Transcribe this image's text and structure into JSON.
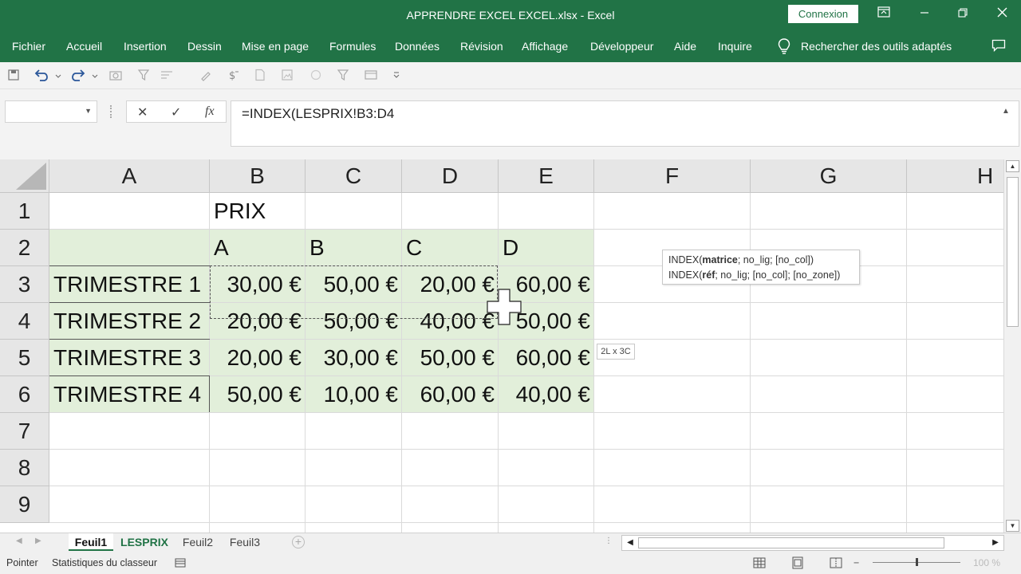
{
  "window": {
    "title": "APPRENDRE EXCEL EXCEL.xlsx  -  Excel",
    "connexion_label": "Connexion"
  },
  "colors": {
    "brand": "#217346",
    "table_fill": "#e2efda"
  },
  "menu": [
    "Fichier",
    "Accueil",
    "Insertion",
    "Dessin",
    "Mise en page",
    "Formules",
    "Données",
    "Révision",
    "Affichage",
    "Développeur",
    "Aide",
    "Inquire",
    "Rechercher des outils adaptés"
  ],
  "formula_bar": {
    "name_box": "",
    "cancel_symbol": "✕",
    "enter_symbol": "✓",
    "fx_symbol": "fx",
    "formula": "=INDEX(LESPRIX!B3:D4"
  },
  "grid": {
    "columns": [
      "A",
      "B",
      "C",
      "D",
      "E",
      "F",
      "G",
      "H"
    ],
    "rows": [
      "1",
      "2",
      "3",
      "4",
      "5",
      "6",
      "7",
      "8",
      "9"
    ],
    "b1": "PRIX",
    "headers_row2": [
      "A",
      "B",
      "C",
      "D"
    ],
    "table": [
      {
        "label": "TRIMESTRE 1",
        "values": [
          "30,00 €",
          "50,00 €",
          "20,00 €",
          "60,00 €"
        ]
      },
      {
        "label": "TRIMESTRE 2",
        "values": [
          "20,00 €",
          "50,00 €",
          "40,00 €",
          "50,00 €"
        ]
      },
      {
        "label": "TRIMESTRE 3",
        "values": [
          "20,00 €",
          "30,00 €",
          "50,00 €",
          "60,00 €"
        ]
      },
      {
        "label": "TRIMESTRE 4",
        "values": [
          "50,00 €",
          "10,00 €",
          "60,00 €",
          "40,00 €"
        ]
      }
    ]
  },
  "tooltip": {
    "line1": {
      "func": "INDEX(",
      "bold": "matrice",
      "rest": "; no_lig; [no_col])"
    },
    "line2": {
      "func": "INDEX(",
      "bold": "réf",
      "rest": "; no_lig; [no_col]; [no_zone])"
    }
  },
  "size_tip": "2L x 3C",
  "sheets": [
    "Feuil1",
    "LESPRIX",
    "Feuil2",
    "Feuil3"
  ],
  "status": {
    "mode": "Pointer",
    "workbook_stats": "Statistiques du classeur",
    "zoom": "100 %"
  }
}
